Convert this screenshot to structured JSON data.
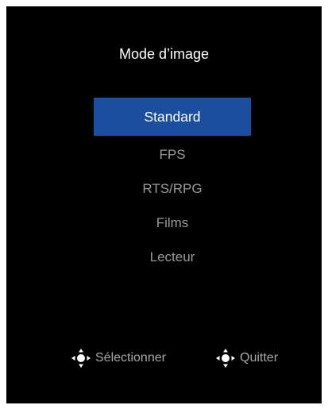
{
  "title": "Mode d’image",
  "menu": {
    "items": [
      {
        "label": "Standard",
        "selected": true
      },
      {
        "label": "FPS",
        "selected": false
      },
      {
        "label": "RTS/RPG",
        "selected": false
      },
      {
        "label": "Films",
        "selected": false
      },
      {
        "label": "Lecteur",
        "selected": false
      }
    ]
  },
  "hints": {
    "select": {
      "icon": "joystick-icon",
      "label": "Sélectionner"
    },
    "quit": {
      "icon": "joystick-icon",
      "label": "Quitter"
    }
  },
  "colors": {
    "background": "#000000",
    "selected": "#1c4ea0",
    "inactive_text": "#9a9a9a"
  }
}
